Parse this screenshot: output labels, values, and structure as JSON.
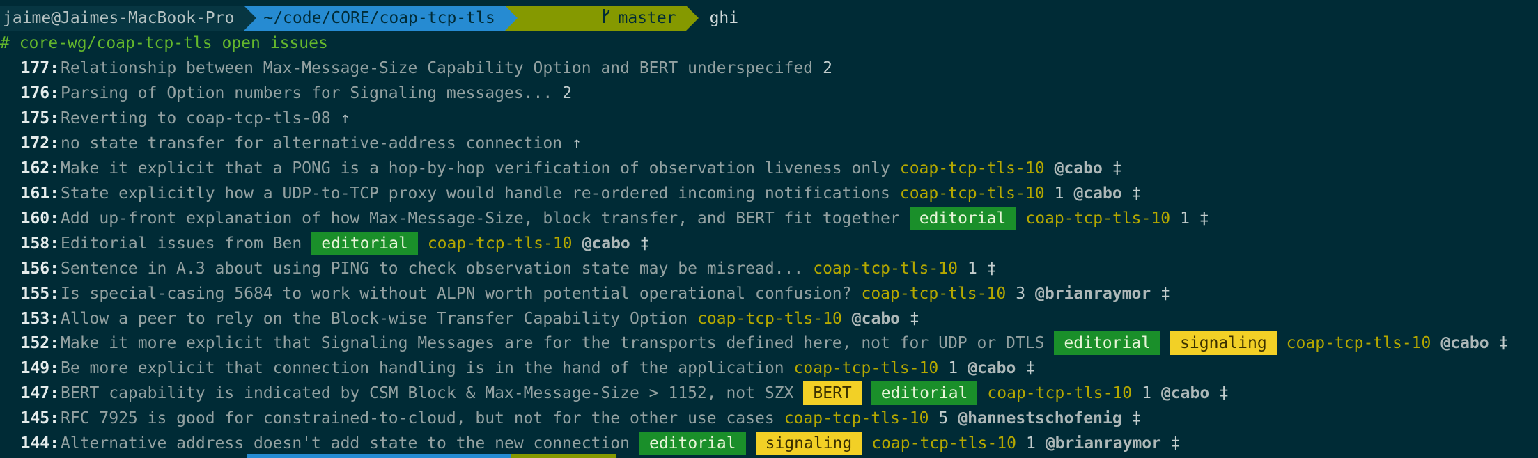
{
  "prompt": {
    "user_host": "jaime@Jaimes-MacBook-Pro",
    "path": "~/code/CORE/coap-tcp-tls",
    "branch": "master",
    "branch_icon": "git-branch-icon",
    "command": "ghi"
  },
  "header": "# core-wg/coap-tcp-tls open issues",
  "colors": {
    "background": "#002b36",
    "path_segment": "#268bd2",
    "git_segment": "#859900",
    "editorial_label": "#1a8f2a",
    "signaling_label": "#f2d026",
    "milestone": "#b5a800"
  },
  "issues": [
    {
      "num": "177:",
      "title": "Relationship between Max-Message-Size Capability Option and BERT underspecifed",
      "labels": [],
      "milestone": "",
      "comments": "2",
      "assignee": "",
      "mark": ""
    },
    {
      "num": "176:",
      "title": "Parsing of Option numbers for Signaling messages...",
      "labels": [],
      "milestone": "",
      "comments": "2",
      "assignee": "",
      "mark": ""
    },
    {
      "num": "175:",
      "title": "Reverting to coap-tcp-tls-08",
      "labels": [],
      "milestone": "",
      "comments": "",
      "assignee": "",
      "mark": "↑"
    },
    {
      "num": "172:",
      "title": "no state transfer for alternative-address connection",
      "labels": [],
      "milestone": "",
      "comments": "",
      "assignee": "",
      "mark": "↑"
    },
    {
      "num": "162:",
      "title": "Make it explicit that a PONG is a hop-by-hop verification of observation liveness only",
      "labels": [],
      "milestone": "coap-tcp-tls-10",
      "comments": "",
      "assignee": "@cabo",
      "mark": "‡"
    },
    {
      "num": "161:",
      "title": "State explicitly how a UDP-to-TCP proxy would handle re-ordered incoming notifications",
      "labels": [],
      "milestone": "coap-tcp-tls-10",
      "comments": "1",
      "assignee": "@cabo",
      "mark": "‡"
    },
    {
      "num": "160:",
      "title": "Add up-front explanation of how Max-Message-Size, block transfer, and BERT fit together",
      "labels": [
        "editorial"
      ],
      "milestone": "coap-tcp-tls-10",
      "comments": "1",
      "assignee": "",
      "mark": "‡"
    },
    {
      "num": "158:",
      "title": "Editorial issues from Ben",
      "labels": [
        "editorial"
      ],
      "milestone": "coap-tcp-tls-10",
      "comments": "",
      "assignee": "@cabo",
      "mark": "‡"
    },
    {
      "num": "156:",
      "title": "Sentence in A.3 about using PING to check observation state may be misread...",
      "labels": [],
      "milestone": "coap-tcp-tls-10",
      "comments": "1",
      "assignee": "",
      "mark": "‡"
    },
    {
      "num": "155:",
      "title": "Is special-casing 5684 to work without ALPN worth potential operational confusion?",
      "labels": [],
      "milestone": "coap-tcp-tls-10",
      "comments": "3",
      "assignee": "@brianraymor",
      "mark": "‡"
    },
    {
      "num": "153:",
      "title": "Allow a peer to rely on the Block-wise Transfer Capability Option",
      "labels": [],
      "milestone": "coap-tcp-tls-10",
      "comments": "",
      "assignee": "@cabo",
      "mark": "‡"
    },
    {
      "num": "152:",
      "title": "Make it more explicit that Signaling Messages are for the transports defined here, not for UDP or DTLS",
      "labels": [
        "editorial",
        "signaling"
      ],
      "milestone": "coap-tcp-tls-10",
      "comments": "",
      "assignee": "@cabo",
      "mark": "‡"
    },
    {
      "num": "149:",
      "title": "Be more explicit that connection handling is in the hand of the application",
      "labels": [],
      "milestone": "coap-tcp-tls-10",
      "comments": "1",
      "assignee": "@cabo",
      "mark": "‡"
    },
    {
      "num": "147:",
      "title": "BERT capability is indicated by CSM Block & Max-Message-Size > 1152, not SZX",
      "labels": [
        "BERT",
        "editorial"
      ],
      "milestone": "coap-tcp-tls-10",
      "comments": "1",
      "assignee": "@cabo",
      "mark": "‡"
    },
    {
      "num": "145:",
      "title": "RFC 7925 is good for constrained-to-cloud, but not for the other use cases",
      "labels": [],
      "milestone": "coap-tcp-tls-10",
      "comments": "5",
      "assignee": "@hannestschofenig",
      "mark": "‡"
    },
    {
      "num": "144:",
      "title": "Alternative address doesn't add state to the new connection",
      "labels": [
        "editorial",
        "signaling"
      ],
      "milestone": "coap-tcp-tls-10",
      "comments": "1",
      "assignee": "@brianraymor",
      "mark": "‡"
    }
  ]
}
